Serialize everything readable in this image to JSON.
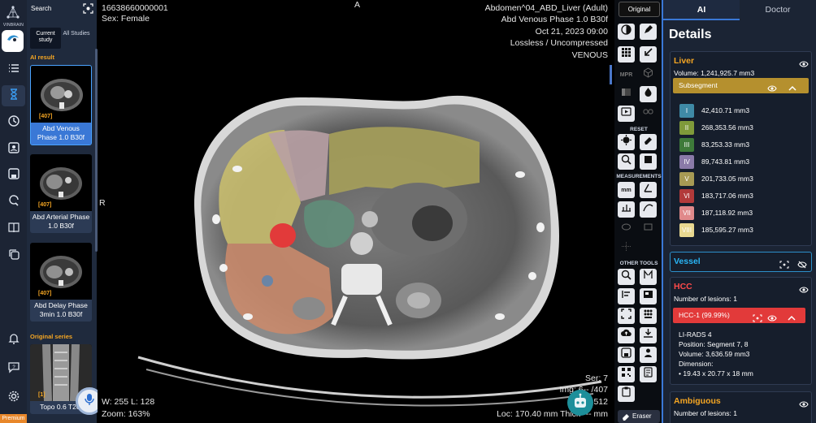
{
  "brand": {
    "name": "VINBRAIN",
    "plan_badge": "Premium"
  },
  "rail_icons": [
    "home-icon",
    "list-icon",
    "hourglass-icon",
    "clock-icon",
    "user-card-icon",
    "save-icon",
    "refresh-search-icon",
    "book-icon",
    "copy-icon",
    "bell-icon",
    "help-chat-icon",
    "settings-icon"
  ],
  "study_panel": {
    "search_label": "Search",
    "tabs": [
      "Current study",
      "All Studies"
    ],
    "ai_result_label": "AI result",
    "original_series_label": "Original series",
    "ai_series": [
      {
        "badge": "[407]",
        "caption": "Abd Venous Phase 1.0 B30f",
        "selected": true
      },
      {
        "badge": "[407]",
        "caption": "Abd Arterial Phase 1.0 B30f",
        "selected": false
      },
      {
        "badge": "[407]",
        "caption": "Abd Delay Phase 3min 1.0 B30f",
        "selected": false
      }
    ],
    "original_series": [
      {
        "badge": "[1]",
        "caption": "Topo 0.6 T20f"
      }
    ]
  },
  "viewer": {
    "patient_id": "16638660000001",
    "sex": "Sex: Female",
    "orientation_top": "A",
    "orientation_left": "R",
    "study_desc": "Abdomen^04_ABD_Liver (Adult)",
    "series_desc": "Abd Venous Phase 1.0 B30f",
    "datetime": "Oct 21, 2023 09:00",
    "compression": "Lossless / Uncompressed",
    "phase": "VENOUS",
    "window_level": "W: 255 L: 128",
    "zoom": "Zoom: 163%",
    "series_num": "Ser: 7",
    "image_num": "Img: 6-- /407",
    "matrix": "512",
    "location": "Loc: 170.40 mm Thick --- mm"
  },
  "tools": {
    "original_label": "Original",
    "sections": [
      "RESET",
      "MEASUREMENTS",
      "OTHER TOOLS"
    ],
    "eraser_label": "Eraser",
    "mpr_label": "MPR",
    "mm_label": "mm"
  },
  "panel": {
    "tabs": [
      "AI",
      "Doctor"
    ],
    "details_title": "Details",
    "liver": {
      "title": "Liver",
      "volume": "Volume: 1,241,925.7 mm3",
      "subsegment_label": "Subsegment",
      "segments": [
        {
          "id": "I",
          "value": "42,410.71 mm3",
          "color": "#3f8aa6"
        },
        {
          "id": "II",
          "value": "268,353.56 mm3",
          "color": "#7f9a3a"
        },
        {
          "id": "III",
          "value": "83,253.33 mm3",
          "color": "#3e7a3a"
        },
        {
          "id": "IV",
          "value": "89,743.81 mm3",
          "color": "#8a7aa8"
        },
        {
          "id": "V",
          "value": "201,733.05 mm3",
          "color": "#a79a54"
        },
        {
          "id": "VI",
          "value": "183,717.06 mm3",
          "color": "#b23a3a"
        },
        {
          "id": "VII",
          "value": "187,118.92 mm3",
          "color": "#e0898a"
        },
        {
          "id": "VIII",
          "value": "185,595.27 mm3",
          "color": "#e8d890"
        }
      ]
    },
    "vessel": {
      "title": "Vessel"
    },
    "hcc": {
      "title": "HCC",
      "lesions": "Number of lesions: 1",
      "lesion_label": "HCC-1 (99.99%)",
      "lirads": "LI-RADS 4",
      "position": "Position: Segment 7, 8",
      "volume": "Volume: 3,636.59 mm3",
      "dimension_label": "Dimension:",
      "dimension_value": "• 19.43 x 20.77 x 18  mm"
    },
    "ambiguous": {
      "title": "Ambiguous",
      "lesions": "Number of lesions: 1"
    }
  },
  "colors": {
    "accent": "#3a78d6",
    "liver": "#f5a623",
    "vessel": "#29b6f6",
    "hcc": "#e23a3a",
    "ambiguous": "#f5a623",
    "subsegment": "#b5902e"
  }
}
